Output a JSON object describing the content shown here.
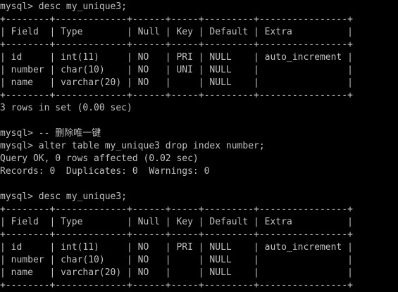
{
  "terminal": {
    "lines": [
      "mysql> desc my_unique3;",
      "+--------+-------------+------+-----+---------+----------------+",
      "| Field  | Type        | Null | Key | Default | Extra          |",
      "+--------+-------------+------+-----+---------+----------------+",
      "| id     | int(11)     | NO   | PRI | NULL    | auto_increment |",
      "| number | char(10)    | NO   | UNI | NULL    |                |",
      "| name   | varchar(20) | NO   |     | NULL    |                |",
      "+--------+-------------+------+-----+---------+----------------+",
      "3 rows in set (0.00 sec)",
      "",
      "mysql> -- 删除唯一键",
      "mysql> alter table my_unique3 drop index number;",
      "Query OK, 0 rows affected (0.02 sec)",
      "Records: 0  Duplicates: 0  Warnings: 0",
      "",
      "mysql> desc my_unique3;",
      "+--------+-------------+------+-----+---------+----------------+",
      "| Field  | Type        | Null | Key | Default | Extra          |",
      "+--------+-------------+------+-----+---------+----------------+",
      "| id     | int(11)     | NO   | PRI | NULL    | auto_increment |",
      "| number | char(10)    | NO   |     | NULL    |                |",
      "| name   | varchar(20) | NO   |     | NULL    |                |",
      "+--------+-------------+------+-----+---------+----------------+"
    ]
  },
  "colors": {
    "background": "#000000",
    "text": "#c0c0c0"
  }
}
